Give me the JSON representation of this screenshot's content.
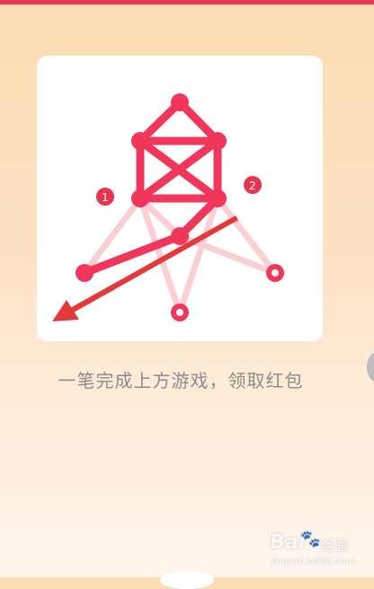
{
  "header": {
    "accent_color": "#e8344f"
  },
  "puzzle": {
    "line_color": "#f0365a",
    "faded_color": "#fad0d4",
    "step_markers": [
      {
        "label": "1",
        "color": "#e8344f"
      },
      {
        "label": "2",
        "color": "#e8344f"
      }
    ],
    "hint_arrow": "red-arrow-icon"
  },
  "instruction": {
    "text": "一笔完成上方游戏，领取红包"
  },
  "watermark": {
    "brand": "Bai",
    "brand_cn": "经验",
    "url": "jingyan.baidu.com"
  }
}
